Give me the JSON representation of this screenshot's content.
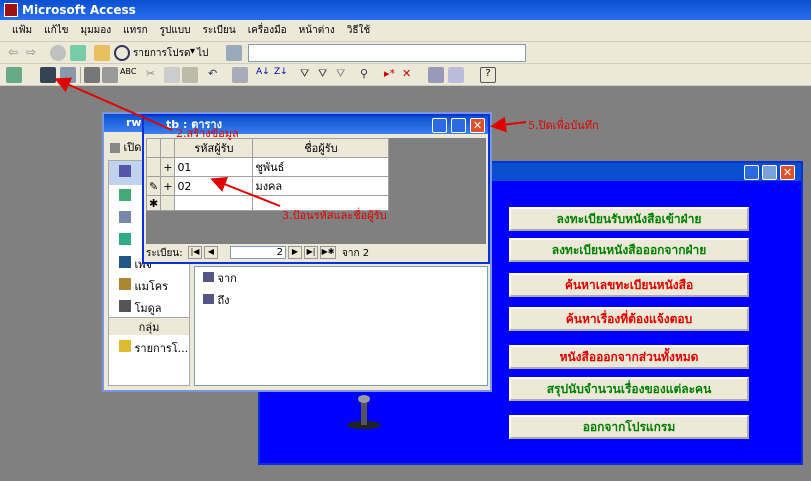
{
  "app": {
    "title": "Microsoft Access"
  },
  "menu": [
    "แฟ้ม",
    "แก้ไข",
    "มุมมอง",
    "แทรก",
    "รูปแบบ",
    "ระเบียน",
    "เครื่องมือ",
    "หน้าต่าง",
    "วิธีใช้"
  ],
  "toolbar": {
    "record_menu_label": "รายการโปรด",
    "goto_label": "ไป"
  },
  "switchboard": {
    "buttons": [
      {
        "label": "ลงทะเบียนรับหนังสือเข้าฝ่าย",
        "color": "green"
      },
      {
        "label": "ลงทะเบียนหนังสือออกจากฝ่าย",
        "color": "green"
      },
      {
        "label": "ค้นหาเลขทะเบียนหนังสือ",
        "color": "red"
      },
      {
        "label": "ค้นหาเรื่องที่ต้องแจ้งตอบ",
        "color": "red"
      },
      {
        "label": "หนังสือออกจากส่วนทั้งหมด",
        "color": "red"
      },
      {
        "label": "สรุปนับจำนวนเรื่องของแต่ละคน",
        "color": "green"
      },
      {
        "label": "ออกจากโปรแกรม",
        "color": "green"
      }
    ]
  },
  "db_window": {
    "title": "rws",
    "open_label": "เปิด",
    "side_items": [
      "ตาราง",
      "แบบสอบถาม",
      "ฟอร์ม",
      "รายงาน",
      "เพจ",
      "แมโคร",
      "โมดูล"
    ],
    "group_label": "กลุ่ม",
    "favorites_label": "รายการโ...",
    "list_items": [
      "จาก",
      "ถึง"
    ]
  },
  "table_window": {
    "title": "tb : ตาราง",
    "columns": [
      "รหัสผู้รับ",
      "ชื่อผู้รับ"
    ],
    "rows": [
      {
        "marker": "+",
        "code": "01",
        "name": "ชูพันธ์"
      },
      {
        "marker": "+",
        "code": "02",
        "name": "มงคล"
      }
    ],
    "nav_label": "ระเบียน:",
    "current_record": "2",
    "of_label": "จาก 2"
  },
  "annotations": {
    "top": "2.สร้างข้อมูล",
    "middle": "3.ป้อนรหัสและชื่อผู้รับ",
    "right": "5.ปิดเพื่อบันทึก"
  }
}
